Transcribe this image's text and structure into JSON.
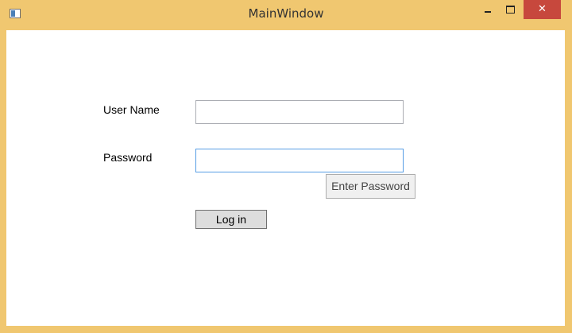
{
  "window": {
    "title": "MainWindow",
    "close_glyph": "✕",
    "frame_color": "#f0c770",
    "close_color": "#c7483d"
  },
  "icons": {
    "app": "app-window-icon",
    "minimize": "minimize-icon",
    "maximize": "maximize-icon",
    "close": "close-icon"
  },
  "form": {
    "username_label": "User Name",
    "password_label": "Password",
    "username_value": "",
    "password_value": "",
    "enter_password_label": "Enter Password",
    "login_label": "Log in"
  }
}
